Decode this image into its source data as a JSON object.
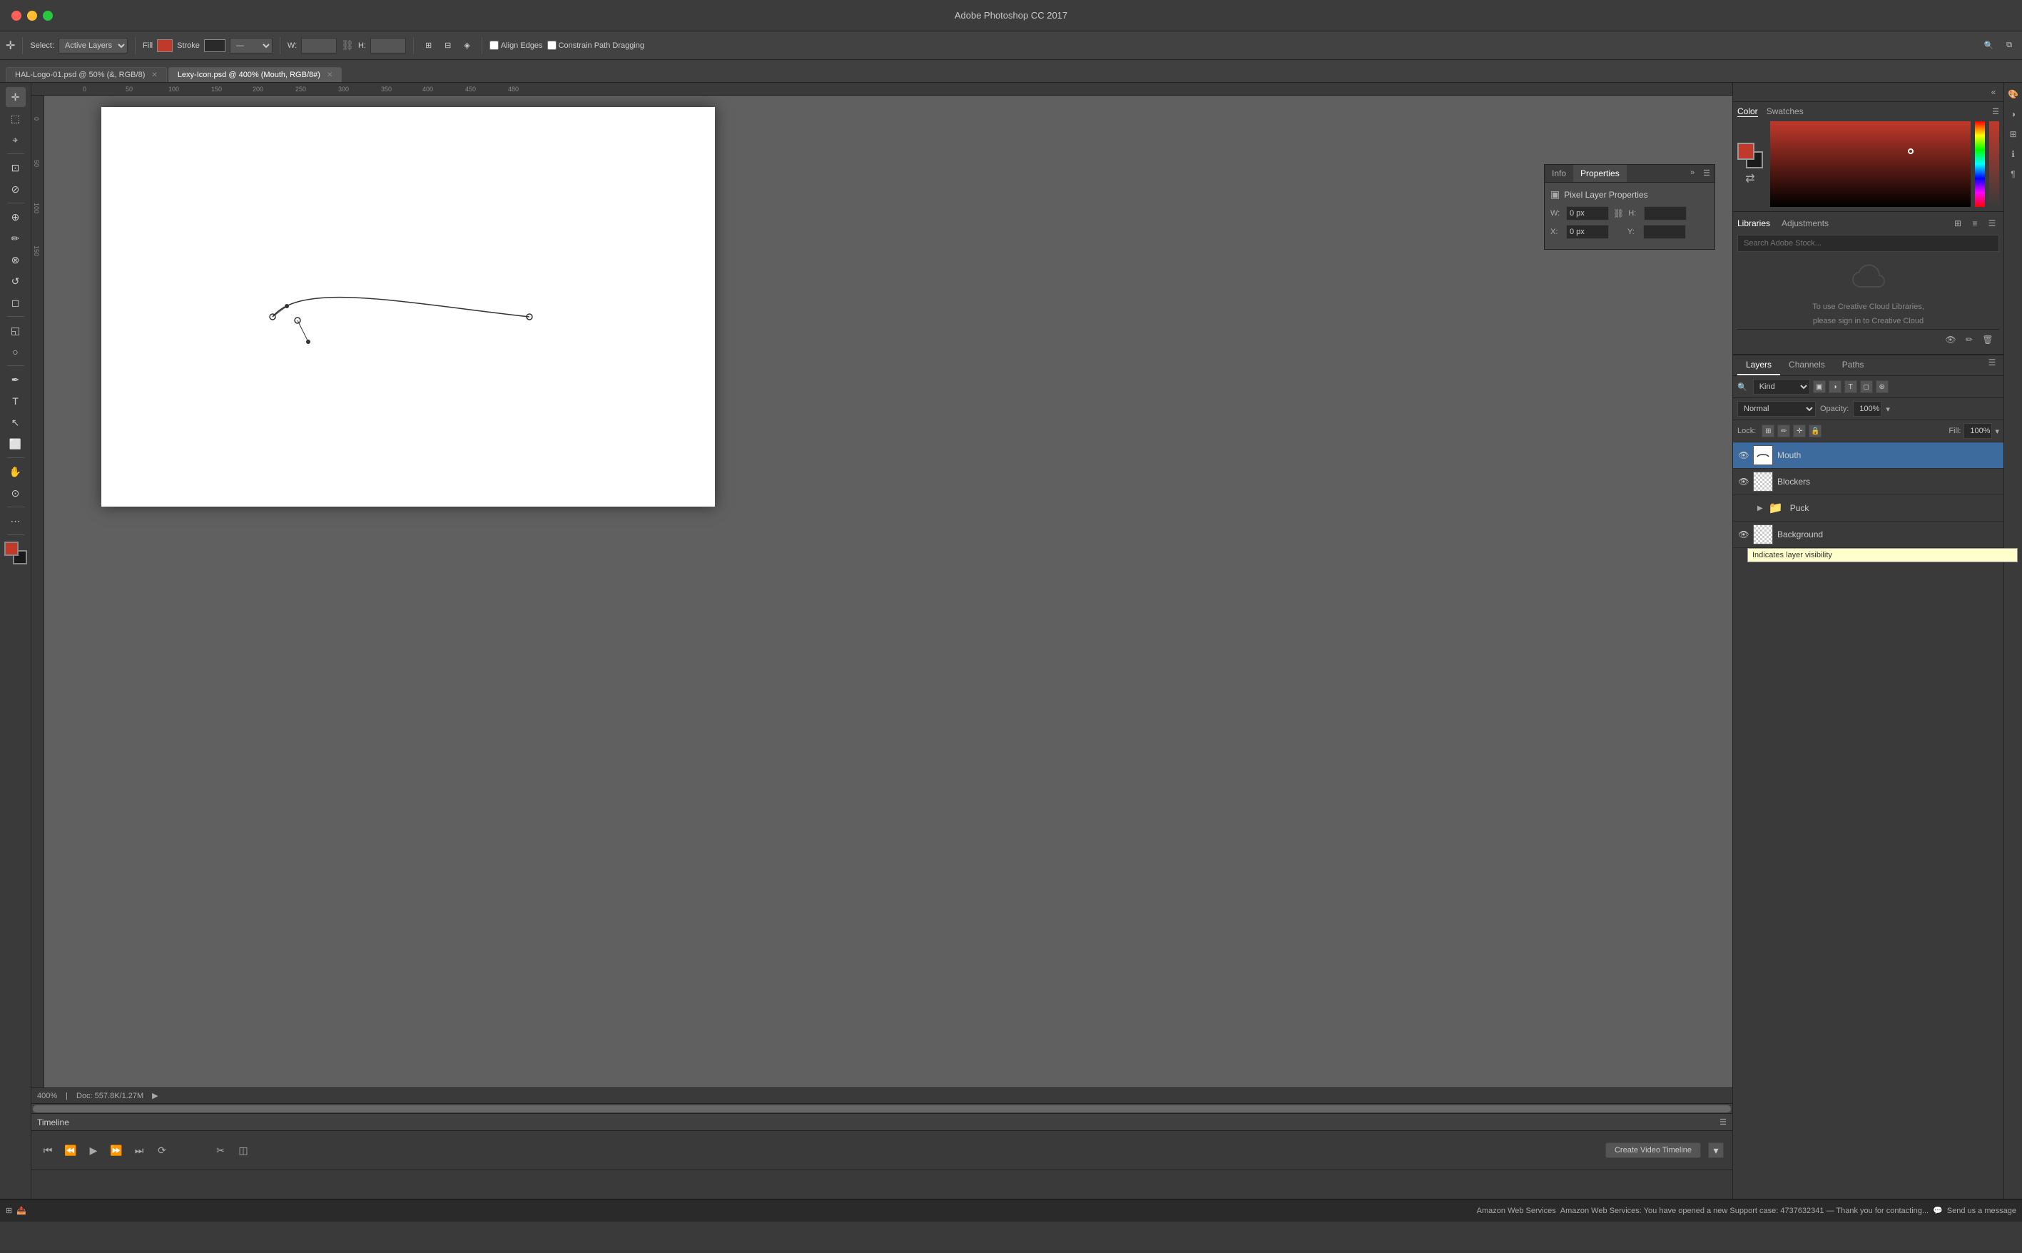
{
  "window": {
    "title": "Adobe Photoshop CC 2017"
  },
  "toolbar": {
    "select_label": "Select:",
    "select_value": "Active Layers",
    "fill_label": "Fill",
    "stroke_label": "Stroke",
    "w_label": "W:",
    "h_label": "H:",
    "align_edges_label": "Align Edges",
    "constrain_label": "Constrain Path Dragging"
  },
  "tabs": [
    {
      "id": "tab1",
      "label": "HAL-Logo-01.psd @ 50% (&, RGB/8)",
      "active": false
    },
    {
      "id": "tab2",
      "label": "Lexy-Icon.psd @ 400% (Mouth, RGB/8#)",
      "active": true
    }
  ],
  "status_bar": {
    "zoom": "400%",
    "doc_size": "Doc: 557.8K/1.27M"
  },
  "color_panel": {
    "tab1": "Color",
    "tab2": "Swatches"
  },
  "libraries_panel": {
    "tab1": "Libraries",
    "tab2": "Adjustments",
    "search_placeholder": "Search Adobe Stock...",
    "cloud_message1": "To use Creative Cloud Libraries,",
    "cloud_message2": "please sign in to Creative Cloud"
  },
  "layers_panel": {
    "tab1": "Layers",
    "tab2": "Channels",
    "tab3": "Paths",
    "filter_kind": "Kind",
    "blend_mode": "Normal",
    "opacity_label": "Opacity:",
    "opacity_value": "100%",
    "fill_label": "Fill:",
    "fill_value": "100%",
    "lock_label": "Lock:",
    "layers": [
      {
        "name": "Mouth",
        "visible": true,
        "selected": true,
        "type": "layer"
      },
      {
        "name": "Blockers",
        "visible": true,
        "selected": false,
        "type": "layer"
      },
      {
        "name": "Puck",
        "visible": true,
        "selected": false,
        "type": "group"
      },
      {
        "name": "Background",
        "visible": true,
        "selected": false,
        "type": "layer"
      }
    ]
  },
  "info_props_panel": {
    "info_tab": "Info",
    "properties_tab": "Properties",
    "header": "Pixel Layer Properties",
    "w_label": "W:",
    "w_value": "0 px",
    "h_label": "H:",
    "x_label": "X:",
    "x_value": "0 px",
    "y_label": "Y:"
  },
  "timeline": {
    "title": "Timeline",
    "create_btn": "Create Video Timeline",
    "dropdown_btn": "▾"
  },
  "tooltip": {
    "text": "Indicates layer visibility"
  },
  "taskbar": {
    "notifications": "Send us a message"
  }
}
